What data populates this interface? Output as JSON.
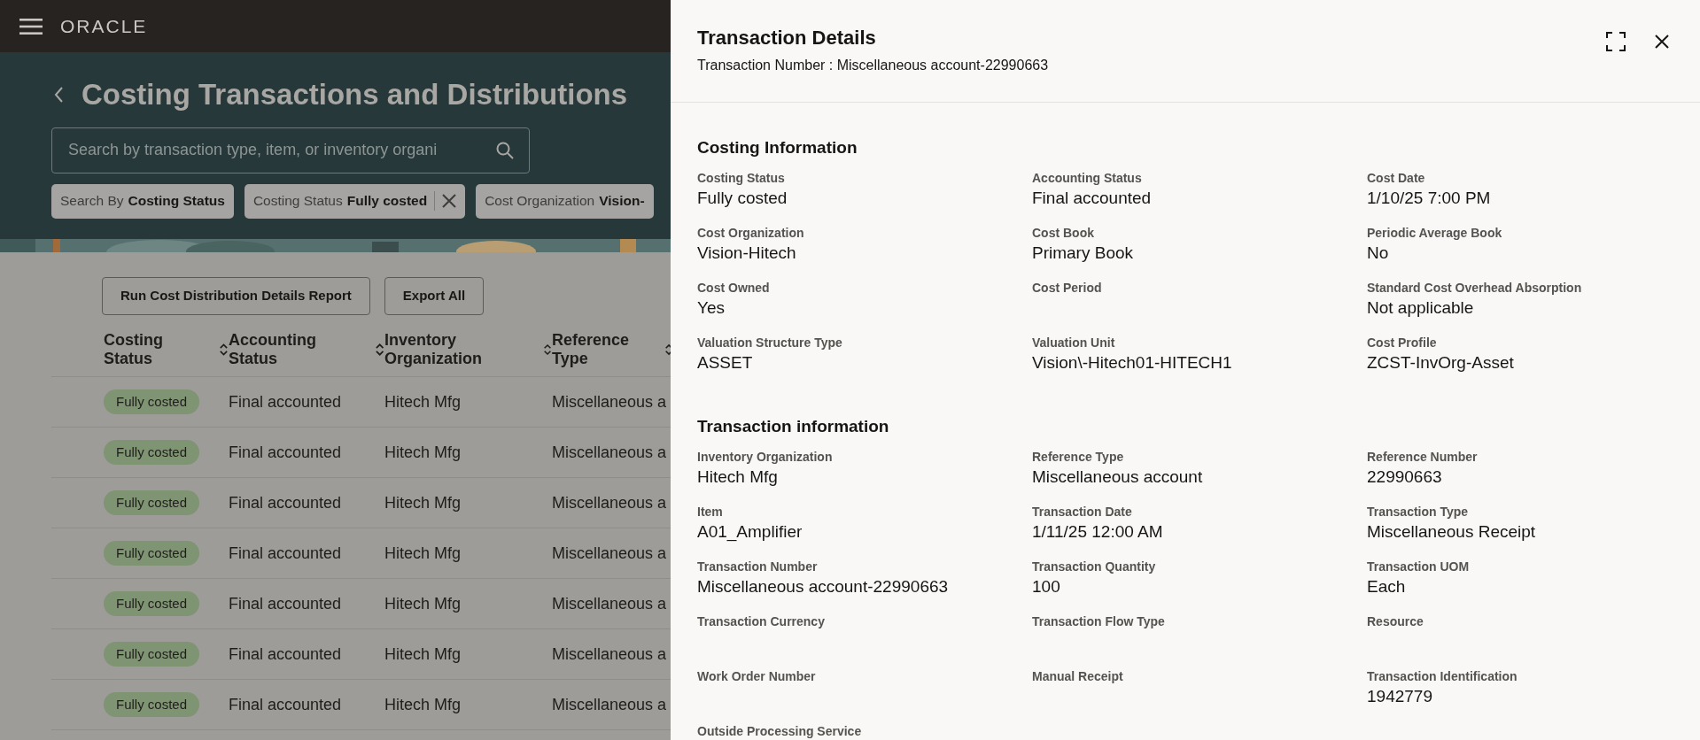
{
  "top_bar": {
    "logo": "ORACLE"
  },
  "page": {
    "title": "Costing Transactions and Distributions",
    "search": {
      "placeholder": "Search by transaction type, item, or inventory organi"
    },
    "filters": [
      {
        "label": "Search By",
        "value": "Costing Status",
        "removable": false
      },
      {
        "label": "Costing Status",
        "value": "Fully costed",
        "removable": true
      },
      {
        "label": "Cost Organization",
        "value": "Vision-",
        "removable": false
      }
    ],
    "buttons": [
      "Run Cost Distribution Details Report",
      "Export All"
    ],
    "table": {
      "columns": [
        "Costing Status",
        "Accounting Status",
        "Inventory Organization",
        "Reference Type"
      ],
      "rows": [
        [
          "Fully costed",
          "Final accounted",
          "Hitech Mfg",
          "Miscellaneous a"
        ],
        [
          "Fully costed",
          "Final accounted",
          "Hitech Mfg",
          "Miscellaneous a"
        ],
        [
          "Fully costed",
          "Final accounted",
          "Hitech Mfg",
          "Miscellaneous a"
        ],
        [
          "Fully costed",
          "Final accounted",
          "Hitech Mfg",
          "Miscellaneous a"
        ],
        [
          "Fully costed",
          "Final accounted",
          "Hitech Mfg",
          "Miscellaneous a"
        ],
        [
          "Fully costed",
          "Final accounted",
          "Hitech Mfg",
          "Miscellaneous a"
        ],
        [
          "Fully costed",
          "Final accounted",
          "Hitech Mfg",
          "Miscellaneous a"
        ]
      ]
    }
  },
  "drawer": {
    "title": "Transaction Details",
    "subtitle": "Transaction Number : Miscellaneous account-22990663",
    "sections": [
      {
        "title": "Costing Information",
        "fields": [
          {
            "label": "Costing Status",
            "value": "Fully costed"
          },
          {
            "label": "Accounting Status",
            "value": "Final accounted"
          },
          {
            "label": "Cost Date",
            "value": "1/10/25 7:00 PM"
          },
          {
            "label": "Cost Organization",
            "value": "Vision-Hitech"
          },
          {
            "label": "Cost Book",
            "value": "Primary Book"
          },
          {
            "label": "Periodic Average Book",
            "value": "No"
          },
          {
            "label": "Cost Owned",
            "value": "Yes"
          },
          {
            "label": "Cost Period"
          },
          {
            "label": "Standard Cost Overhead Absorption",
            "value": "Not applicable"
          },
          {
            "label": "Valuation Structure Type",
            "value": "ASSET"
          },
          {
            "label": "Valuation Unit",
            "value": "Vision\\-Hitech01-HITECH1"
          },
          {
            "label": "Cost Profile",
            "value": "ZCST-InvOrg-Asset"
          }
        ]
      },
      {
        "title": "Transaction information",
        "fields": [
          {
            "label": "Inventory Organization",
            "value": "Hitech Mfg"
          },
          {
            "label": "Reference Type",
            "value": "Miscellaneous account"
          },
          {
            "label": "Reference Number",
            "value": "22990663"
          },
          {
            "label": "Item",
            "value": "A01_Amplifier"
          },
          {
            "label": "Transaction Date",
            "value": "1/11/25 12:00 AM"
          },
          {
            "label": "Transaction Type",
            "value": "Miscellaneous Receipt"
          },
          {
            "label": "Transaction Number",
            "value": "Miscellaneous account-22990663"
          },
          {
            "label": "Transaction Quantity",
            "value": "100"
          },
          {
            "label": "Transaction UOM",
            "value": "Each"
          },
          {
            "label": "Transaction Currency"
          },
          {
            "label": "Transaction Flow Type"
          },
          {
            "label": "Resource"
          },
          {
            "label": "Work Order Number"
          },
          {
            "label": "Manual Receipt"
          },
          {
            "label": "Transaction Identification",
            "value": "1942779"
          },
          {
            "label": "Outside Processing Service"
          }
        ]
      }
    ]
  }
}
